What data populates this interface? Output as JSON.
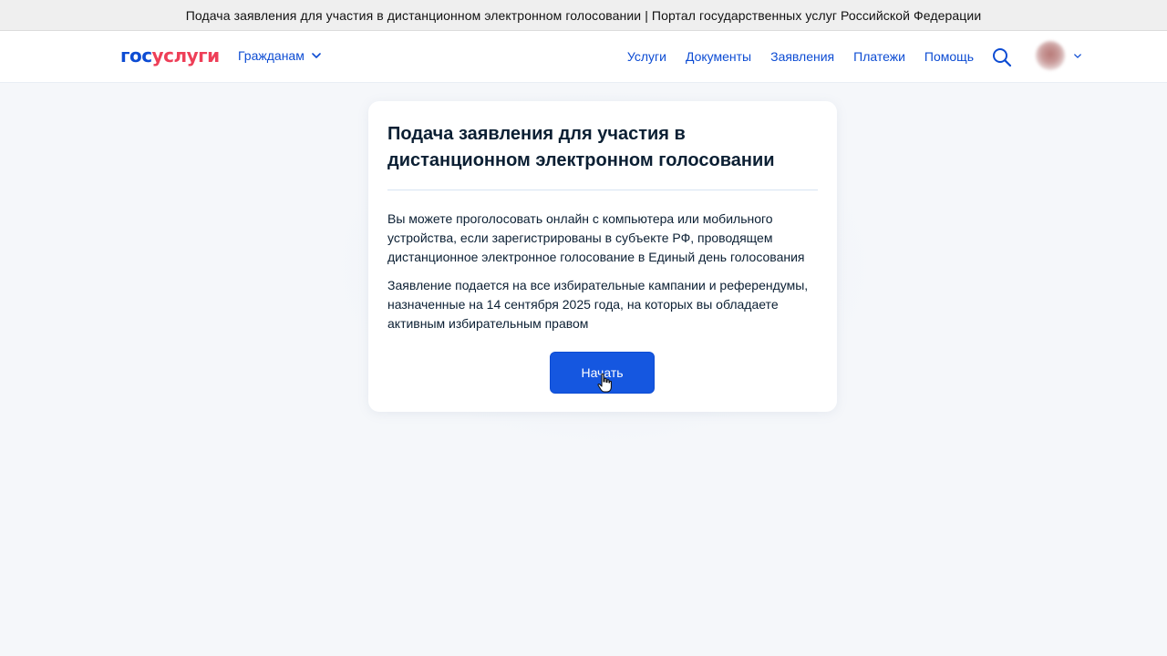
{
  "window": {
    "title": "Подача заявления для участия в дистанционном электронном голосовании | Портал государственных услуг Российской Федерации"
  },
  "header": {
    "logo_part1": "гос",
    "logo_part2": "услуги",
    "audience_label": "Гражданам",
    "nav": [
      "Услуги",
      "Документы",
      "Заявления",
      "Платежи",
      "Помощь"
    ],
    "search_icon": "search-icon",
    "avatar_icon": "user-avatar"
  },
  "card": {
    "title": "Подача заявления для участия в дистанционном электронном голосовании",
    "paragraph1": "Вы можете проголосовать онлайн с компьютера или мобильного устройства, если зарегистрированы в субъекте РФ, проводящем дистанционное электронное голосование в Единый день голосования",
    "paragraph2": "Заявление подается на все избирательные кампании и референдумы, назначенные на 14 сентября 2025 года, на которых вы обладаете активным избирательным правом",
    "start_button": "Начать"
  },
  "colors": {
    "accent": "#0d4cd3",
    "logo_red": "#ee3f58",
    "button": "#1557e0",
    "page_bg": "#f5f7fa",
    "text": "#0b1f33"
  }
}
